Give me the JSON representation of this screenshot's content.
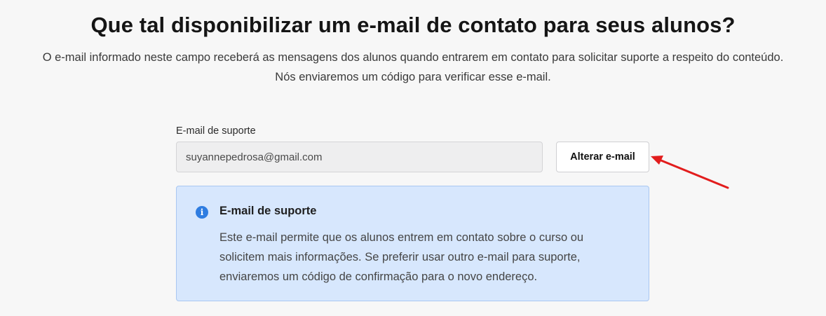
{
  "header": {
    "title": "Que tal disponibilizar um e-mail de contato para seus alunos?",
    "subtitle_line1": "O e-mail informado neste campo receberá as mensagens dos alunos quando entrarem em contato para solicitar suporte a respeito do conteúdo.",
    "subtitle_line2": "Nós enviaremos um código para verificar esse e-mail."
  },
  "form": {
    "email_label": "E-mail de suporte",
    "email_value": "suyannepedrosa@gmail.com",
    "change_button_label": "Alterar e-mail"
  },
  "info": {
    "icon": "info-icon",
    "icon_glyph": "i",
    "title": "E-mail de suporte",
    "line1": "Este e-mail permite que os alunos entrem em contato sobre o curso ou",
    "line2": "solicitem mais informações. Se preferir usar outro e-mail para suporte,",
    "line3": "enviaremos um código de confirmação para o novo endereço."
  },
  "colors": {
    "background": "#f7f7f7",
    "info_bg": "#d7e7fd",
    "info_border": "#a9c7f1",
    "info_icon": "#2f7de1",
    "annotation_arrow": "#e21d1d"
  }
}
